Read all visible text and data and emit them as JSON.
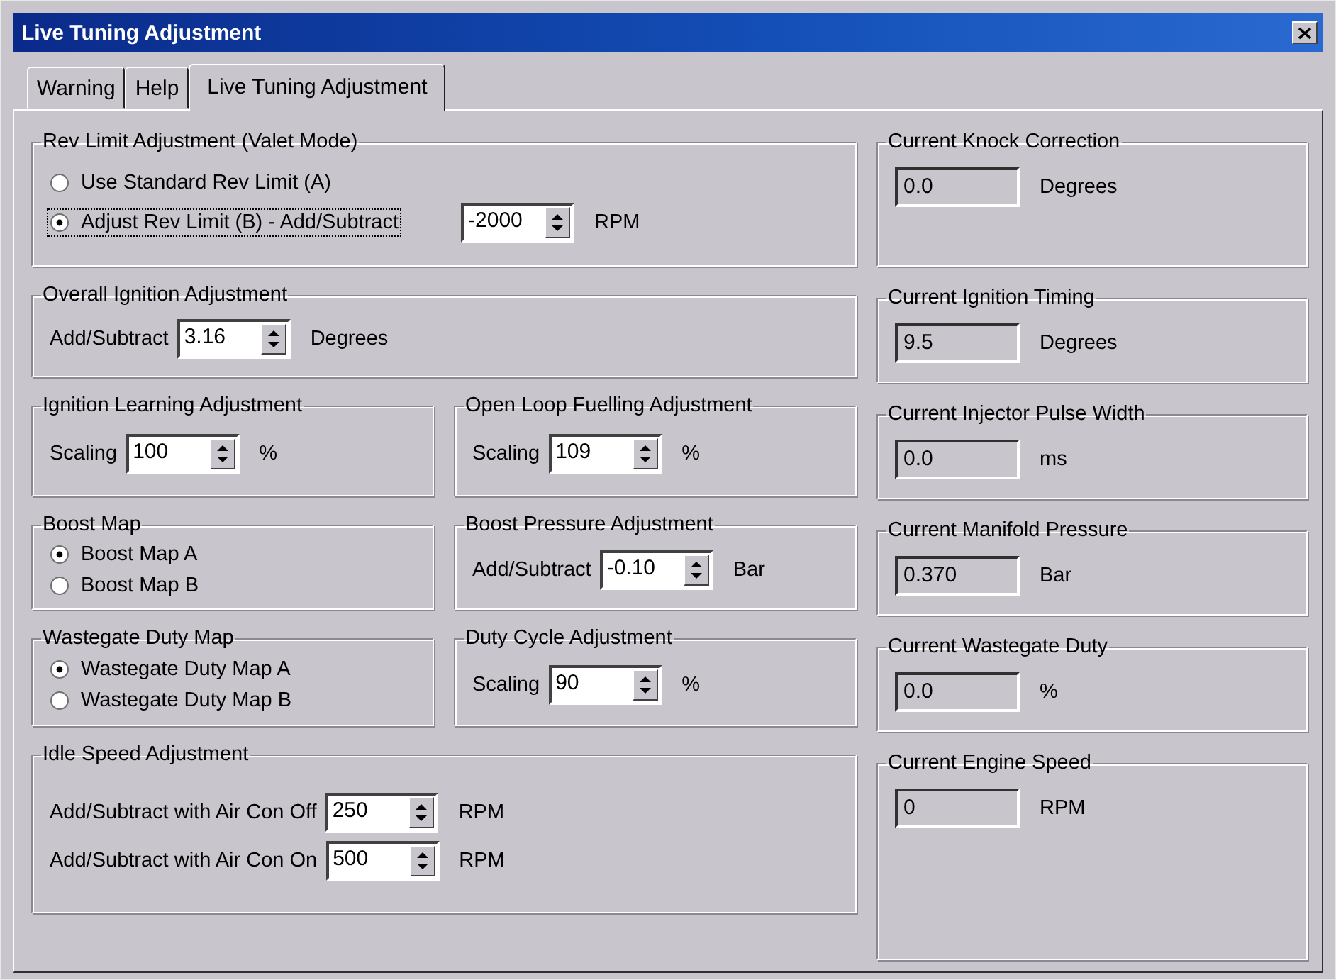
{
  "window": {
    "title": "Live Tuning Adjustment"
  },
  "tabs": [
    {
      "label": "Warning",
      "selected": false
    },
    {
      "label": "Help",
      "selected": false
    },
    {
      "label": "Live Tuning Adjustment",
      "selected": true
    }
  ],
  "left_rows": [
    [
      {
        "kind": "radio",
        "title": "Rev Limit Adjustment (Valet Mode)",
        "options": [
          {
            "label": "Use Standard Rev Limit (A)",
            "selected": false
          },
          {
            "label": "Adjust Rev Limit (B) - Add/Subtract",
            "selected": true,
            "focused": true,
            "spin": {
              "value": "-2000",
              "unit": "RPM"
            }
          }
        ]
      }
    ],
    [
      {
        "kind": "spin",
        "title": "Overall Ignition Adjustment",
        "fields": [
          {
            "label": "Add/Subtract",
            "value": "3.16",
            "unit": "Degrees"
          }
        ]
      }
    ],
    [
      {
        "kind": "spin",
        "title": "Ignition Learning Adjustment",
        "fields": [
          {
            "label": "Scaling",
            "value": "100",
            "unit": "%"
          }
        ]
      },
      {
        "kind": "spin",
        "title": "Open Loop Fuelling Adjustment",
        "fields": [
          {
            "label": "Scaling",
            "value": "109",
            "unit": "%"
          }
        ]
      }
    ],
    [
      {
        "kind": "radio",
        "title": "Boost Map",
        "options": [
          {
            "label": "Boost Map A",
            "selected": true
          },
          {
            "label": "Boost Map B",
            "selected": false
          }
        ]
      },
      {
        "kind": "spin",
        "title": "Boost Pressure Adjustment",
        "fields": [
          {
            "label": "Add/Subtract",
            "value": "-0.10",
            "unit": "Bar"
          }
        ]
      }
    ],
    [
      {
        "kind": "radio",
        "title": "Wastegate Duty Map",
        "options": [
          {
            "label": "Wastegate Duty Map A",
            "selected": true
          },
          {
            "label": "Wastegate Duty Map B",
            "selected": false
          }
        ]
      },
      {
        "kind": "spin",
        "title": "Duty Cycle Adjustment",
        "fields": [
          {
            "label": "Scaling",
            "value": "90",
            "unit": "%"
          }
        ]
      }
    ],
    [
      {
        "kind": "spin",
        "title": "Idle Speed Adjustment",
        "fields": [
          {
            "label": "Add/Subtract with Air Con Off",
            "value": "250",
            "unit": "RPM"
          },
          {
            "label": "Add/Subtract with Air Con On",
            "value": "500",
            "unit": "RPM"
          }
        ]
      }
    ]
  ],
  "readouts": [
    {
      "title": "Current Knock Correction",
      "value": "0.0",
      "unit": "Degrees"
    },
    {
      "title": "Current Ignition Timing",
      "value": "9.5",
      "unit": "Degrees"
    },
    {
      "title": "Current Injector Pulse Width",
      "value": "0.0",
      "unit": "ms"
    },
    {
      "title": "Current Manifold Pressure",
      "value": "0.370",
      "unit": "Bar"
    },
    {
      "title": "Current Wastegate Duty",
      "value": "0.0",
      "unit": "%"
    },
    {
      "title": "Current Engine Speed",
      "value": "0",
      "unit": "RPM"
    }
  ]
}
